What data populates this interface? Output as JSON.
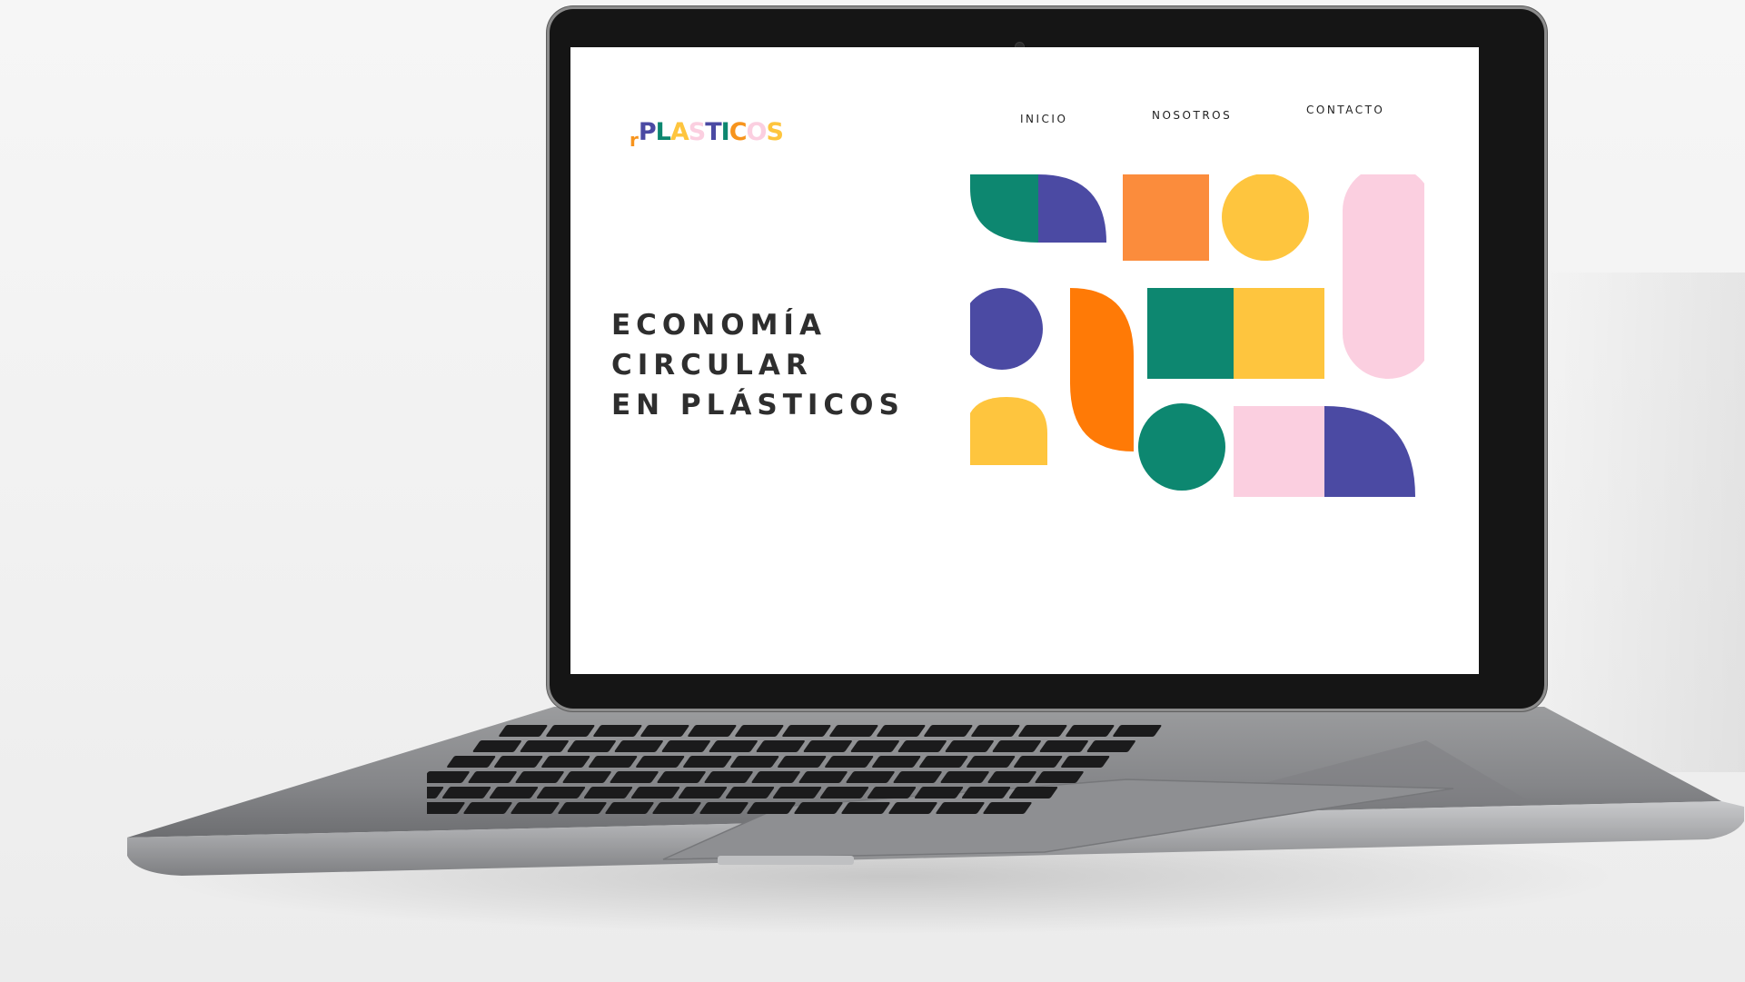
{
  "site": {
    "logo": {
      "prefix": "r",
      "letters": [
        "P",
        "L",
        "A",
        "S",
        "T",
        "I",
        "C",
        "O",
        "S"
      ]
    },
    "nav": {
      "inicio": "INICIO",
      "nosotros": "NOSOTROS",
      "contacto": "CONTACTO"
    },
    "hero": {
      "line1": "ECONOMÍA",
      "line2": "CIRCULAR",
      "line3": "EN PLÁSTICOS"
    }
  },
  "colors": {
    "teal": "#0d8770",
    "indigo": "#4b4aa3",
    "orange": "#fb8c3c",
    "deep_orange": "#ff7a06",
    "yellow": "#fec53e",
    "pink": "#fbcfe0",
    "text_dark": "#2e2e2e",
    "logo": [
      "#f7941d",
      "#4b4aa3",
      "#0d8770",
      "#fec53e",
      "#fbcfe0",
      "#4b4aa3",
      "#0d8770",
      "#f7941d",
      "#fbcfe0",
      "#fec53e"
    ]
  },
  "decoration": {
    "shapes": [
      "teal-quarter-circle",
      "indigo-quarter-circle",
      "orange-square",
      "yellow-circle",
      "pink-pill",
      "indigo-circle",
      "orange-leaf",
      "teal-square",
      "yellow-square",
      "yellow-arch",
      "teal-circle",
      "pink-rectangle",
      "indigo-quarter-circle"
    ]
  }
}
